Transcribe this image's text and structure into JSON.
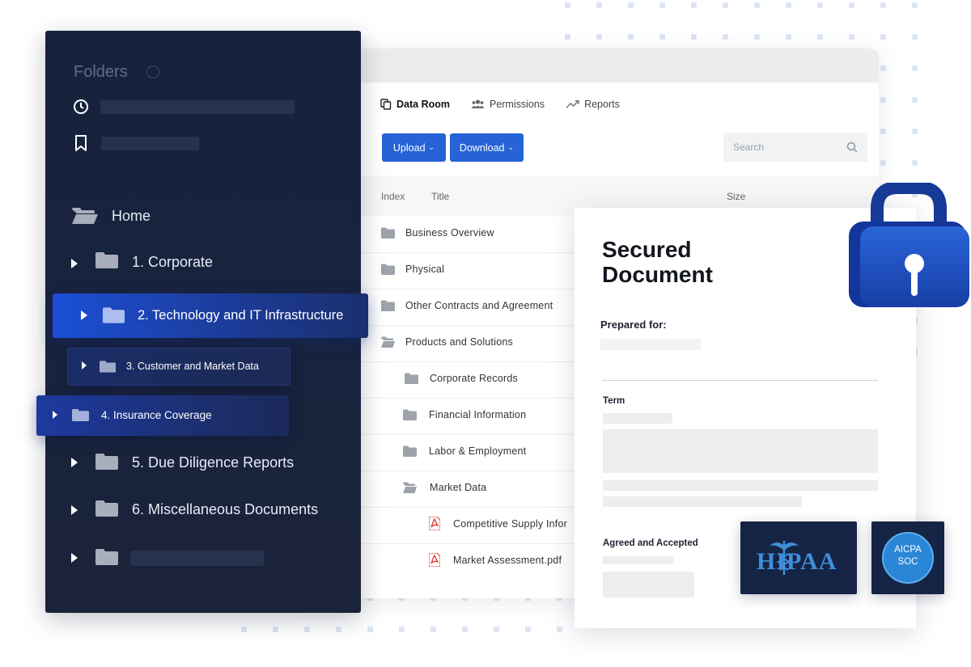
{
  "sidebar": {
    "title": "Folders",
    "home": "Home",
    "folders": [
      {
        "label": "1. Corporate"
      },
      {
        "label": "2. Technology and IT Infrastructure"
      },
      {
        "label": "3. Customer and Market Data"
      },
      {
        "label": "4. Insurance Coverage"
      },
      {
        "label": "5. Due Diligence Reports"
      },
      {
        "label": "6. Miscellaneous Documents"
      }
    ]
  },
  "dataroom": {
    "tabs": [
      "Data Room",
      "Permissions",
      "Reports"
    ],
    "upload_label": "Upload",
    "download_label": "Download",
    "search_placeholder": "Search",
    "columns": [
      "Index",
      "Title",
      "Size"
    ],
    "rows": [
      {
        "title": "Business Overview",
        "type": "folder"
      },
      {
        "title": "Physical",
        "type": "folder"
      },
      {
        "title": "Other Contracts and Agreement",
        "type": "folder"
      },
      {
        "title": "Products and Solutions",
        "type": "folder-open"
      },
      {
        "title": "Corporate Records",
        "type": "folder"
      },
      {
        "title": "Financial Information",
        "type": "folder"
      },
      {
        "title": "Labor & Employment",
        "type": "folder"
      },
      {
        "title": "Market Data",
        "type": "folder-open"
      },
      {
        "title": "Competitive Supply Infor",
        "type": "pdf"
      },
      {
        "title": "Market Assessment.pdf",
        "type": "pdf"
      }
    ]
  },
  "secured_doc": {
    "title_line1": "Secured",
    "title_line2": "Document",
    "prepared_for": "Prepared for:",
    "term": "Term",
    "agreed": "Agreed and Accepted"
  },
  "badges": {
    "hipaa": "HIPAA",
    "aicpa_top": "AICPA",
    "aicpa_bottom": "SOC"
  },
  "colors": {
    "sidebar_bg": "#17223d",
    "accent_blue": "#2563d6",
    "lock_blue": "#1a4fc0"
  }
}
